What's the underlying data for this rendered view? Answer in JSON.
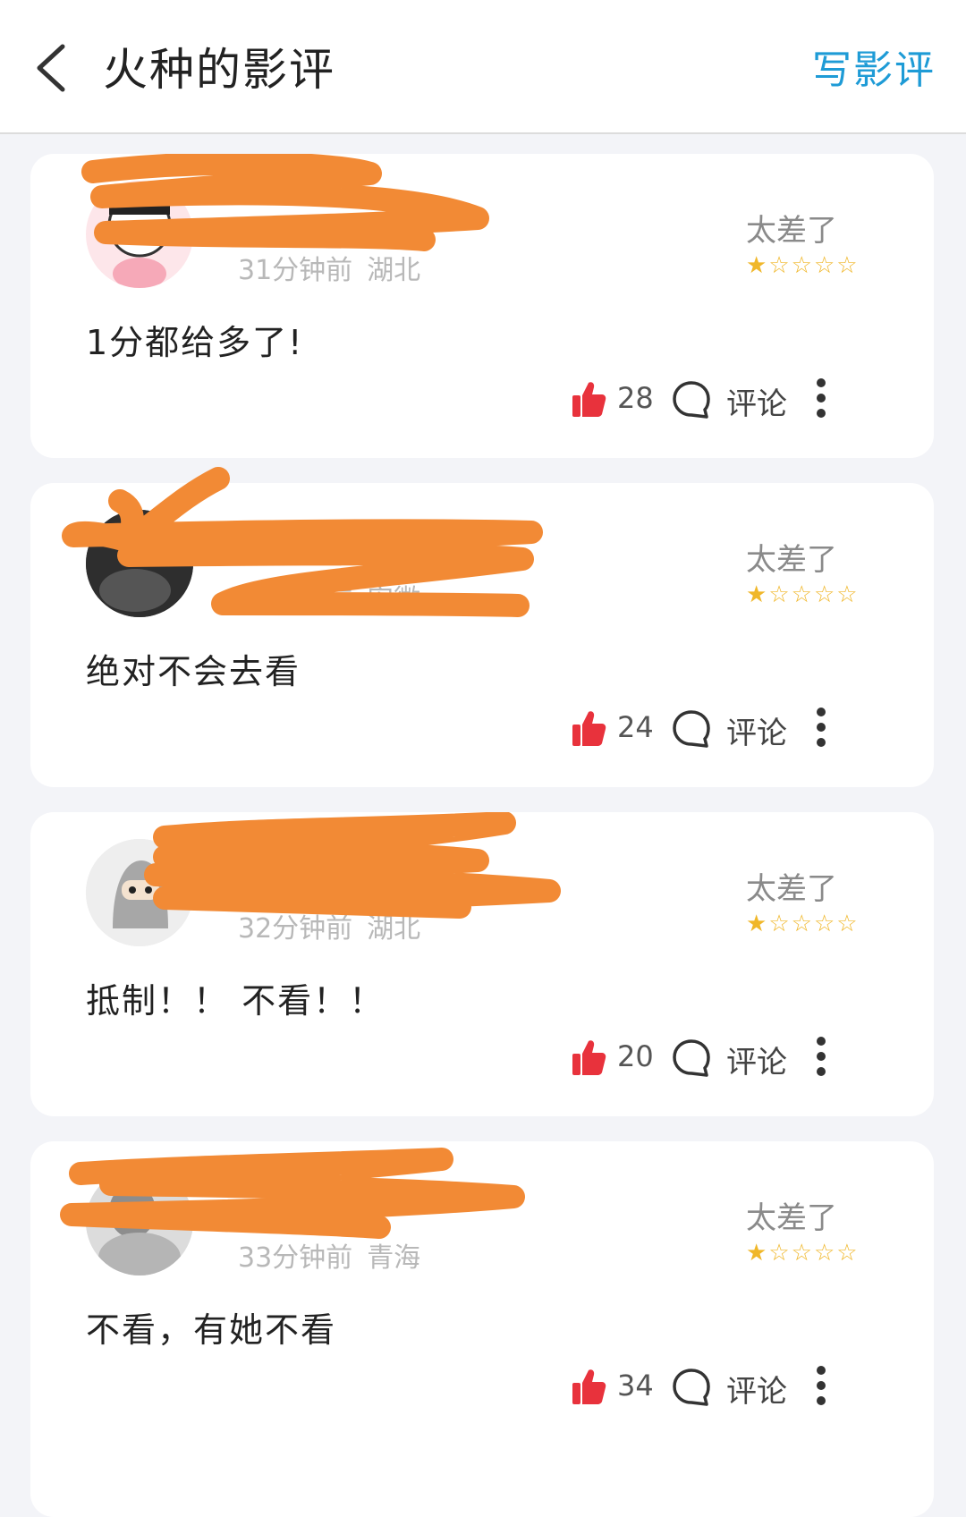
{
  "header": {
    "back_icon": "chevron-left-icon",
    "title": "火种的影评",
    "write_label": "写影评"
  },
  "colors": {
    "accent": "#1e9bd6",
    "star": "#f0b72a",
    "like": "#e8323c",
    "scribble": "#f28a35"
  },
  "reviews": [
    {
      "time": "31分钟前",
      "location": "湖北",
      "rating_label": "太差了",
      "rating": 1,
      "text": "1分都给多了!",
      "likes": "28",
      "comment_label": "评论"
    },
    {
      "time": "32分钟前",
      "location": "安徽",
      "rating_label": "太差了",
      "rating": 1,
      "text": "绝对不会去看",
      "likes": "24",
      "comment_label": "评论"
    },
    {
      "time": "32分钟前",
      "location": "湖北",
      "rating_label": "太差了",
      "rating": 1,
      "text": "抵制！！ 不看！！",
      "likes": "20",
      "comment_label": "评论"
    },
    {
      "time": "33分钟前",
      "location": "青海",
      "rating_label": "太差了",
      "rating": 1,
      "text": "不看，有她不看",
      "likes": "34",
      "comment_label": "评论"
    }
  ]
}
